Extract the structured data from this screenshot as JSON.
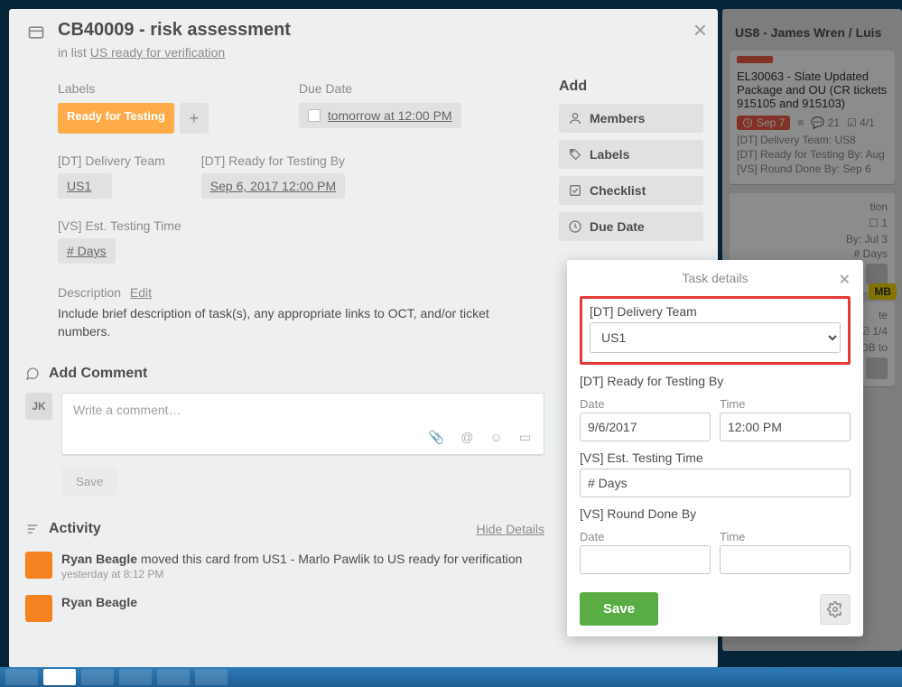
{
  "card": {
    "title": "CB40009 - risk assessment",
    "in_list_prefix": "in list ",
    "in_list_name": "US ready for verification",
    "labels_heading": "Labels",
    "label_text": "Ready for Testing",
    "due_heading": "Due Date",
    "due_text": "tomorrow at 12:00 PM",
    "cf1_label": "[DT] Delivery Team",
    "cf1_value": "US1",
    "cf2_label": "[DT] Ready for Testing By",
    "cf2_value": "Sep 6, 2017 12:00 PM",
    "cf3_label": "[VS] Est. Testing Time",
    "cf3_value": "# Days",
    "desc_heading": "Description",
    "desc_edit": "Edit",
    "desc_body": "Include brief description of task(s), any appropriate links to OCT, and/or ticket numbers.",
    "add_comment_heading": "Add Comment",
    "avatar_initials": "JK",
    "comment_placeholder": "Write a comment…",
    "comment_save": "Save",
    "activity_heading": "Activity",
    "hide_details": "Hide Details",
    "activity1_actor": "Ryan Beagle",
    "activity1_rest": " moved this card from US1 - Marlo Pawlik to US ready for verification",
    "activity1_time": "yesterday at 8:12 PM",
    "activity2_actor": "Ryan Beagle"
  },
  "sidebar": {
    "add_heading": "Add",
    "members": "Members",
    "labels": "Labels",
    "checklist": "Checklist",
    "due_date": "Due Date"
  },
  "popover": {
    "title": "Task details",
    "field1_label": "[DT] Delivery Team",
    "field1_value": "US1",
    "field2_label": "[DT] Ready for Testing By",
    "date_label": "Date",
    "time_label": "Time",
    "field2_date": "9/6/2017",
    "field2_time": "12:00 PM",
    "field3_label": "[VS] Est. Testing Time",
    "field3_value": "# Days",
    "field4_label": "[VS] Round Done By",
    "field4_date": "",
    "field4_time": "",
    "save": "Save"
  },
  "board": {
    "list_title": "US8 - James Wren / Luis",
    "card1": {
      "title": "EL30063 - Slate Updated Package and OU (CR tickets 915105 and 915103)",
      "due": "Sep 7",
      "comments": "21",
      "checklist": "4/1",
      "dt": "[DT] Delivery Team: US8",
      "rt": "[DT] Ready for Testing By: Aug",
      "rd": "[VS] Round Done By: Sep 6"
    },
    "mb_badge": "MB",
    "frag_tion": "tion",
    "frag_1": "1",
    "frag_by": "By: Jul 3",
    "frag_days": "# Days",
    "frag_te": "te",
    "frag_14": "1/4",
    "frag_eob": "EOB to"
  }
}
